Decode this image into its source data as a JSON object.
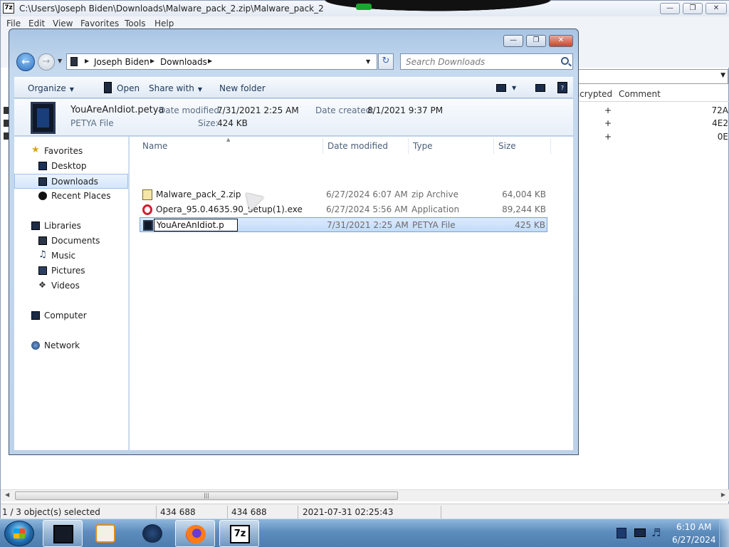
{
  "zip_window": {
    "title": "C:\\Users\\Joseph Biden\\Downloads\\Malware_pack_2.zip\\Malware_pack_2",
    "app_icon_text": "7z",
    "menu": [
      "File",
      "Edit",
      "View",
      "Favorites",
      "Tools",
      "Help"
    ],
    "columns": {
      "encrypted": "Encrypted",
      "comment": "Comment"
    },
    "rows": [
      {
        "encrypted": "+",
        "crc": "72A"
      },
      {
        "encrypted": "+",
        "crc": "4E2"
      },
      {
        "encrypted": "+",
        "crc": "0E"
      }
    ],
    "status": {
      "selection": "1 / 3 object(s) selected",
      "size": "434 688",
      "packed_size": "434 688",
      "modified": "2021-07-31 02:25:43"
    }
  },
  "explorer": {
    "breadcrumb": [
      "Joseph Biden",
      "Downloads"
    ],
    "search_placeholder": "Search Downloads",
    "toolbar": {
      "organize": "Organize",
      "open": "Open",
      "share_with": "Share with",
      "new_folder": "New folder"
    },
    "details": {
      "filename": "YouAreAnIdiot.petya",
      "filetype": "PETYA File",
      "date_modified_label": "Date modified:",
      "date_modified": "7/31/2021 2:25 AM",
      "size_label": "Size:",
      "size": "424 KB",
      "date_created_label": "Date created:",
      "date_created": "8/1/2021 9:37 PM"
    },
    "nav": {
      "favorites": "Favorites",
      "desktop": "Desktop",
      "downloads": "Downloads",
      "recent_places": "Recent Places",
      "libraries": "Libraries",
      "documents": "Documents",
      "music": "Music",
      "pictures": "Pictures",
      "videos": "Videos",
      "computer": "Computer",
      "network": "Network"
    },
    "columns": {
      "name": "Name",
      "date_modified": "Date modified",
      "type": "Type",
      "size": "Size"
    },
    "files": [
      {
        "name": "Malware_pack_2.zip",
        "date": "6/27/2024 6:07 AM",
        "type": "zip Archive",
        "size": "64,004 KB",
        "icon": "zip-icon"
      },
      {
        "name": "Opera_95.0.4635.90_Setup(1).exe",
        "date": "6/27/2024 5:56 AM",
        "type": "Application",
        "size": "89,244 KB",
        "icon": "opera-icon"
      },
      {
        "name": "YouAreAnIdiot.p",
        "date": "7/31/2021 2:25 AM",
        "type": "PETYA File",
        "size": "425 KB",
        "icon": "petya-file-icon"
      }
    ]
  },
  "taskbar": {
    "time": "6:10 AM",
    "date": "6/27/2024",
    "apps": [
      "explorer-icon",
      "media-player-icon",
      "browser-globe-icon",
      "firefox-icon",
      "7zip-icon"
    ]
  },
  "colors": {
    "selection": "#c1dcfa",
    "taskbar": "#5d8dbd",
    "accent": "#2f6fc0"
  }
}
